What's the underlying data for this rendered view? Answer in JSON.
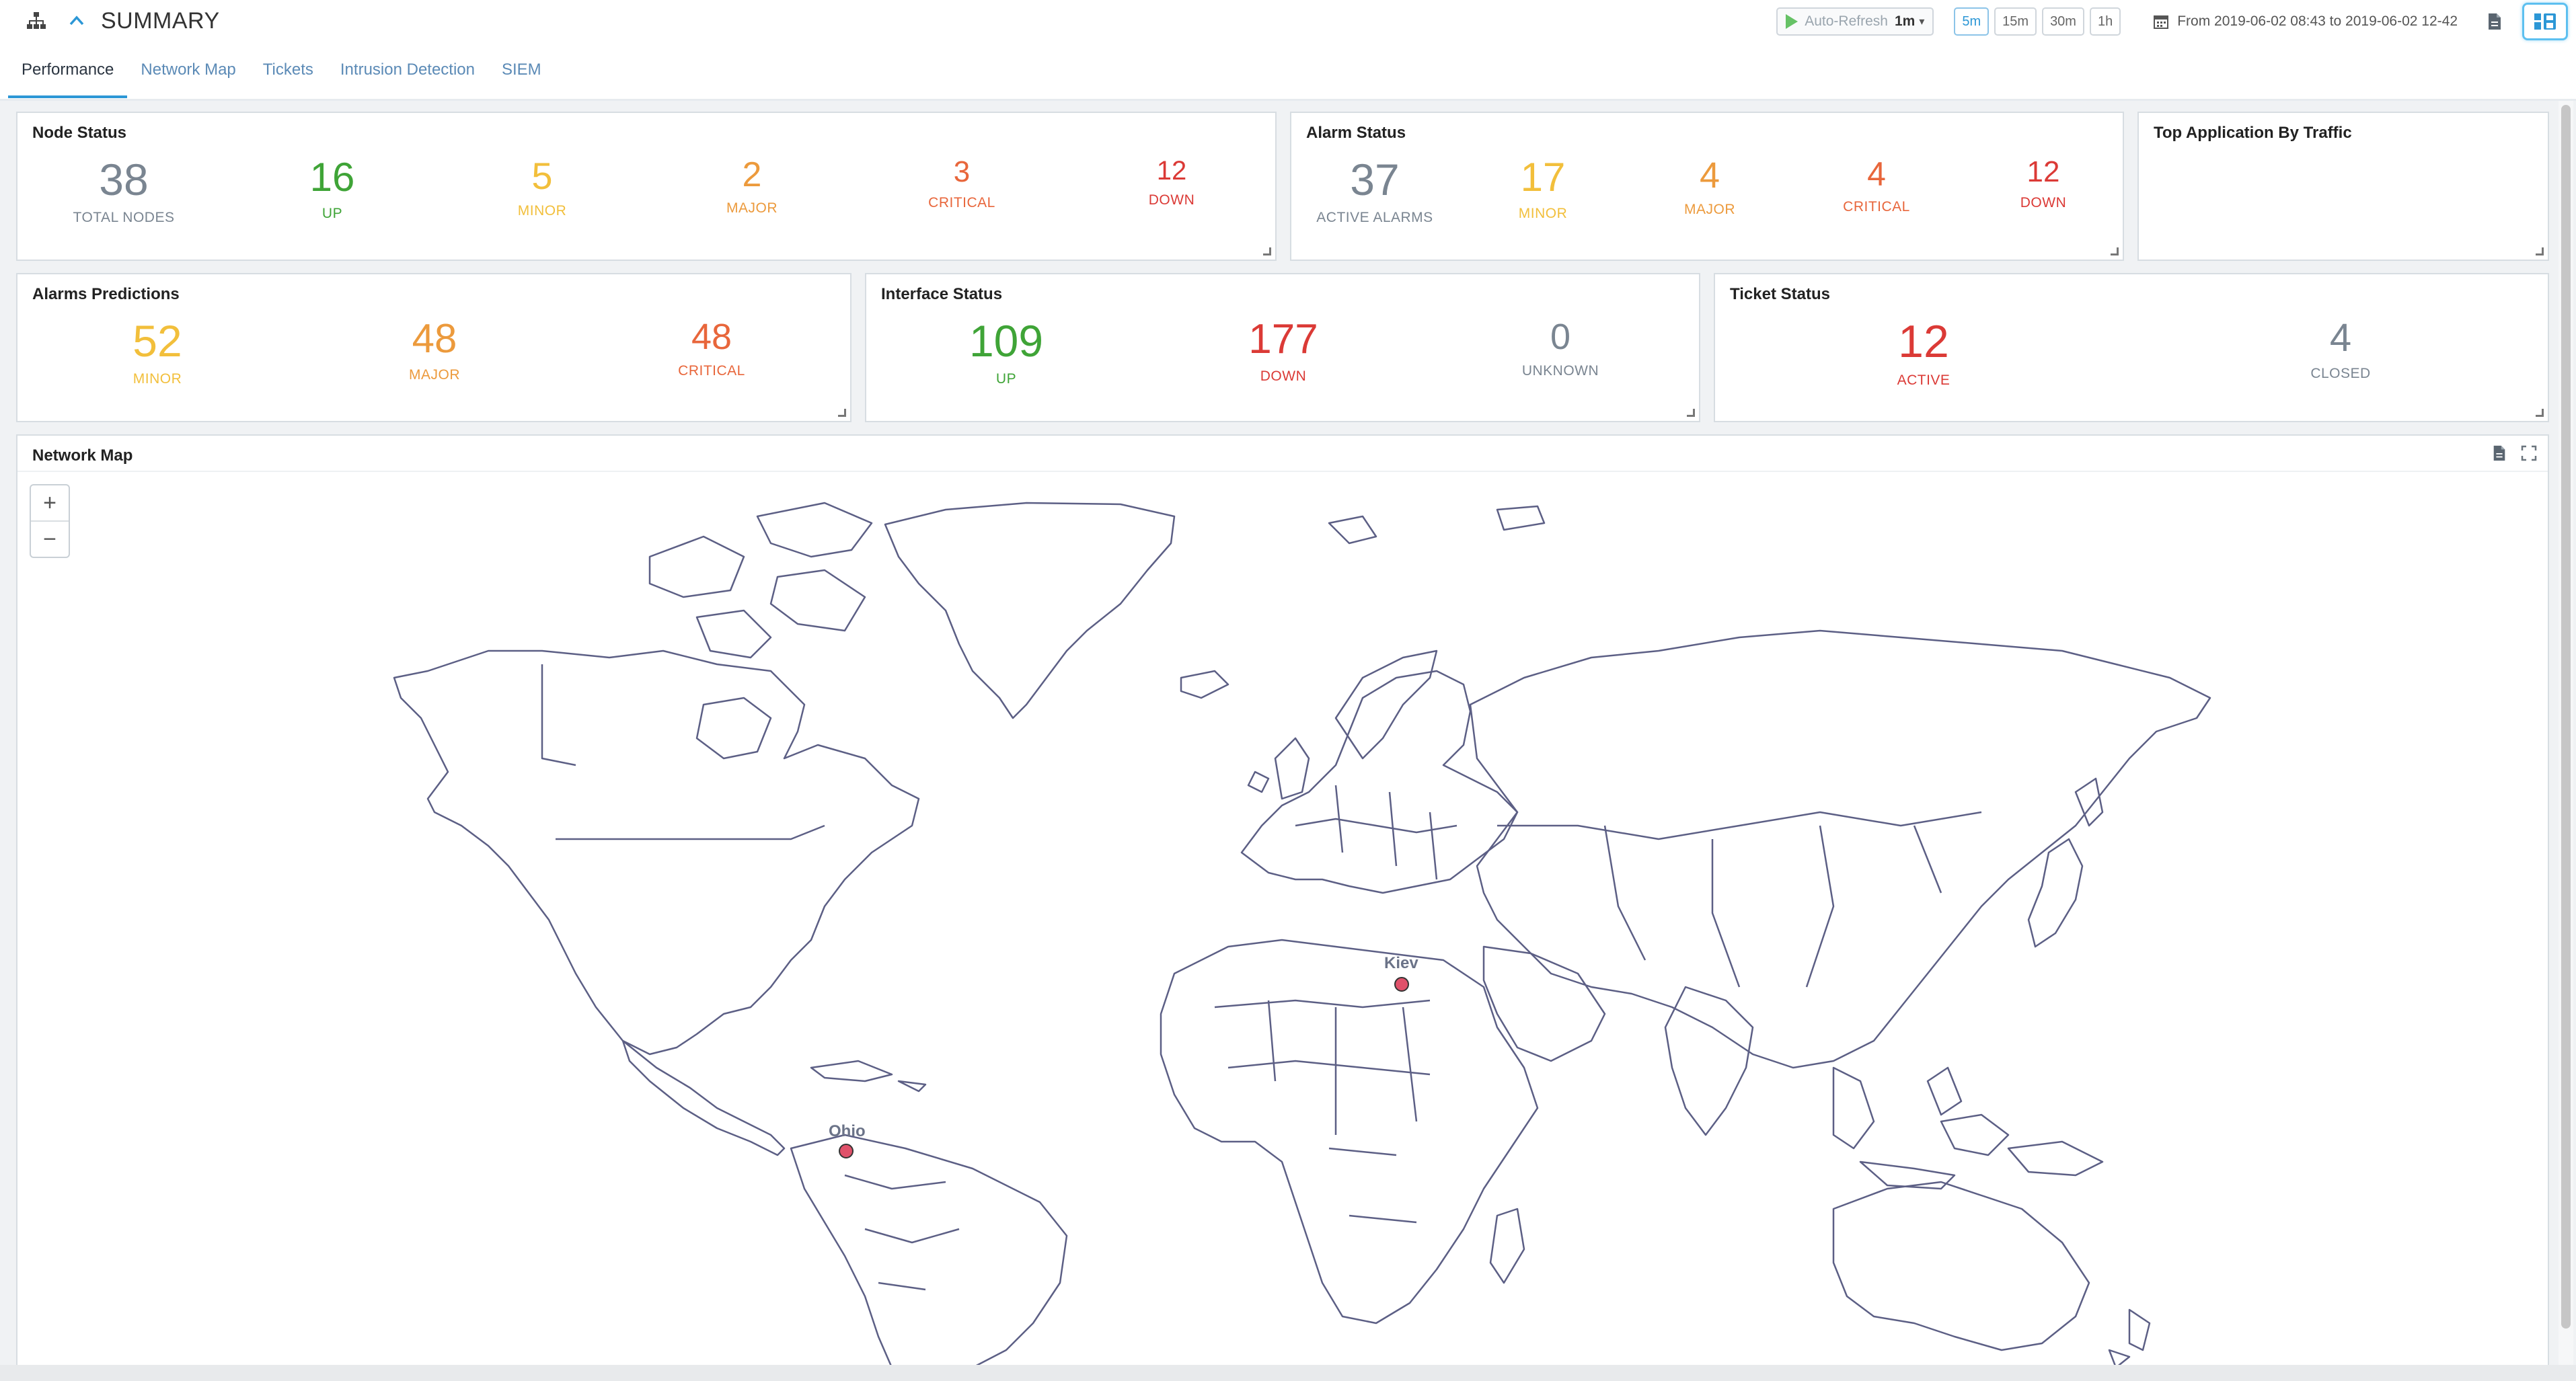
{
  "header": {
    "title": "SUMMARY",
    "auto_refresh_label": "Auto-Refresh",
    "auto_refresh_interval": "1m",
    "intervals": [
      "5m",
      "15m",
      "30m",
      "1h"
    ],
    "active_interval": "5m",
    "date_range": "From 2019-06-02 08:43 to 2019-06-02 12-42"
  },
  "tabs": [
    {
      "label": "Performance",
      "active": true
    },
    {
      "label": "Network Map",
      "active": false
    },
    {
      "label": "Tickets",
      "active": false
    },
    {
      "label": "Intrusion Detection",
      "active": false
    },
    {
      "label": "SIEM",
      "active": false
    }
  ],
  "colors": {
    "gray": "#7a8591",
    "green": "#3fa437",
    "yellow": "#f2bf3b",
    "orange": "#ec9a3c",
    "redorange": "#e8663b",
    "red": "#db3a36",
    "accent": "#2c97d6"
  },
  "node_status": {
    "title": "Node Status",
    "metrics": [
      {
        "value": "38",
        "label": "TOTAL NODES"
      },
      {
        "value": "16",
        "label": "UP"
      },
      {
        "value": "5",
        "label": "MINOR"
      },
      {
        "value": "2",
        "label": "MAJOR"
      },
      {
        "value": "3",
        "label": "CRITICAL"
      },
      {
        "value": "12",
        "label": "DOWN"
      }
    ]
  },
  "alarm_status": {
    "title": "Alarm Status",
    "metrics": [
      {
        "value": "37",
        "label": "ACTIVE ALARMS"
      },
      {
        "value": "17",
        "label": "MINOR"
      },
      {
        "value": "4",
        "label": "MAJOR"
      },
      {
        "value": "4",
        "label": "CRITICAL"
      },
      {
        "value": "12",
        "label": "DOWN"
      }
    ]
  },
  "top_app": {
    "title": "Top Application By Traffic"
  },
  "alarm_predictions": {
    "title": "Alarms Predictions",
    "metrics": [
      {
        "value": "52",
        "label": "MINOR"
      },
      {
        "value": "48",
        "label": "MAJOR"
      },
      {
        "value": "48",
        "label": "CRITICAL"
      }
    ]
  },
  "interface_status": {
    "title": "Interface Status",
    "metrics": [
      {
        "value": "109",
        "label": "UP"
      },
      {
        "value": "177",
        "label": "DOWN"
      },
      {
        "value": "0",
        "label": "UNKNOWN"
      }
    ]
  },
  "ticket_status": {
    "title": "Ticket Status",
    "metrics": [
      {
        "value": "12",
        "label": "ACTIVE"
      },
      {
        "value": "4",
        "label": "CLOSED"
      }
    ]
  },
  "network_map": {
    "title": "Network Map",
    "zoom_in": "+",
    "zoom_out": "−",
    "markers": [
      {
        "label": "Ohio"
      },
      {
        "label": "Kiev"
      }
    ]
  }
}
